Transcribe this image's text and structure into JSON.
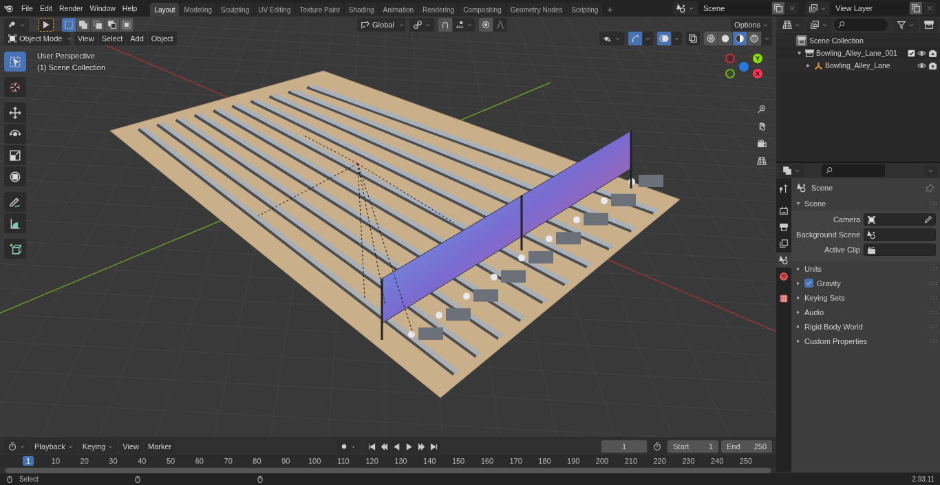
{
  "menu": [
    "File",
    "Edit",
    "Render",
    "Window",
    "Help"
  ],
  "workspaces": [
    {
      "label": "Layout",
      "selected": true
    },
    {
      "label": "Modeling",
      "selected": false
    },
    {
      "label": "Sculpting",
      "selected": false
    },
    {
      "label": "UV Editing",
      "selected": false
    },
    {
      "label": "Texture Paint",
      "selected": false
    },
    {
      "label": "Shading",
      "selected": false
    },
    {
      "label": "Animation",
      "selected": false
    },
    {
      "label": "Rendering",
      "selected": false
    },
    {
      "label": "Compositing",
      "selected": false
    },
    {
      "label": "Geometry Nodes",
      "selected": false
    },
    {
      "label": "Scripting",
      "selected": false
    }
  ],
  "add_workspace": "+",
  "scene": {
    "name": "Scene"
  },
  "view_layer": {
    "name": "View Layer"
  },
  "viewport": {
    "select_modes": [
      {
        "selected": true
      },
      {
        "selected": false
      },
      {
        "selected": false
      },
      {
        "selected": false
      },
      {
        "selected": false
      }
    ],
    "orientation": "Global",
    "options": "Options",
    "mode": "Object Mode",
    "menus": [
      "View",
      "Select",
      "Add",
      "Object"
    ],
    "toggles": [
      {
        "kind": "gizmo",
        "on": true
      },
      {
        "kind": "overlay",
        "on": true
      },
      {
        "kind": "xray",
        "on": false
      }
    ],
    "shading_modes": [
      {
        "kind": "wireframe",
        "selected": false
      },
      {
        "kind": "solid",
        "selected": false
      },
      {
        "kind": "material",
        "selected": true
      },
      {
        "kind": "rendered",
        "selected": false
      }
    ],
    "view_name": "User Perspective",
    "collection_label": "(1) Scene Collection",
    "tools": [
      {
        "kind": "select",
        "selected": true
      },
      {
        "kind": "cursor",
        "selected": false
      },
      {
        "kind": "move",
        "selected": false
      },
      {
        "kind": "rotate",
        "selected": false
      },
      {
        "kind": "scale",
        "selected": false
      },
      {
        "kind": "transform",
        "selected": false
      },
      {
        "kind": "annotate",
        "selected": false
      },
      {
        "kind": "measure",
        "selected": false
      },
      {
        "kind": "add-cube",
        "selected": false
      }
    ],
    "gizmo_axes": [
      {
        "label": "Y",
        "color": "#8bdc00"
      },
      {
        "label": "X",
        "color": "#ff3352"
      }
    ]
  },
  "outliner": {
    "tree": [
      {
        "label": "Scene Collection",
        "kind": "scene-collection",
        "children": [
          {
            "label": "Bowling_Alley_Lane_001",
            "kind": "collection",
            "expanded": true,
            "checked": true,
            "children": [
              {
                "label": "Bowling_Alley_Lane",
                "kind": "armature",
                "expanded": false
              }
            ]
          }
        ]
      }
    ]
  },
  "properties": {
    "tabs": [
      {
        "kind": "tool",
        "selected": false
      },
      {
        "kind": "render",
        "selected": false
      },
      {
        "kind": "output",
        "selected": false
      },
      {
        "kind": "view-layer",
        "selected": false
      },
      {
        "kind": "scene",
        "selected": true
      },
      {
        "kind": "world",
        "selected": false
      },
      {
        "kind": "texture",
        "selected": false
      }
    ],
    "context": "Scene",
    "panels": [
      {
        "title": "Scene",
        "expanded": true,
        "fields": [
          {
            "label": "Camera",
            "kind": "object"
          },
          {
            "label": "Background Scene",
            "kind": "scene"
          },
          {
            "label": "Active Clip",
            "kind": "clip"
          }
        ]
      },
      {
        "title": "Units",
        "expanded": false
      },
      {
        "title": "Gravity",
        "expanded": false,
        "checked": true
      },
      {
        "title": "Keying Sets",
        "expanded": false
      },
      {
        "title": "Audio",
        "expanded": false
      },
      {
        "title": "Rigid Body World",
        "expanded": false
      },
      {
        "title": "Custom Properties",
        "expanded": false
      }
    ]
  },
  "timeline": {
    "menus": [
      {
        "label": "Playback",
        "dropdown": true
      },
      {
        "label": "Keying",
        "dropdown": true
      },
      {
        "label": "View",
        "dropdown": false
      },
      {
        "label": "Marker",
        "dropdown": false
      }
    ],
    "auto_keying": false,
    "current_frame": "1",
    "start_label": "Start",
    "start": "1",
    "end_label": "End",
    "end": "250",
    "ruler": [
      {
        "label": "1",
        "current": true
      },
      {
        "label": "10",
        "current": false
      },
      {
        "label": "20",
        "current": false
      },
      {
        "label": "30",
        "current": false
      },
      {
        "label": "40",
        "current": false
      },
      {
        "label": "50",
        "current": false
      },
      {
        "label": "60",
        "current": false
      },
      {
        "label": "70",
        "current": false
      },
      {
        "label": "80",
        "current": false
      },
      {
        "label": "90",
        "current": false
      },
      {
        "label": "100",
        "current": false
      },
      {
        "label": "110",
        "current": false
      },
      {
        "label": "120",
        "current": false
      },
      {
        "label": "130",
        "current": false
      },
      {
        "label": "140",
        "current": false
      },
      {
        "label": "150",
        "current": false
      },
      {
        "label": "160",
        "current": false
      },
      {
        "label": "170",
        "current": false
      },
      {
        "label": "180",
        "current": false
      },
      {
        "label": "190",
        "current": false
      },
      {
        "label": "200",
        "current": false
      },
      {
        "label": "210",
        "current": false
      },
      {
        "label": "220",
        "current": false
      },
      {
        "label": "230",
        "current": false
      },
      {
        "label": "240",
        "current": false
      },
      {
        "label": "250",
        "current": false
      }
    ]
  },
  "status": {
    "action": "Select",
    "version": "2.93.11"
  }
}
